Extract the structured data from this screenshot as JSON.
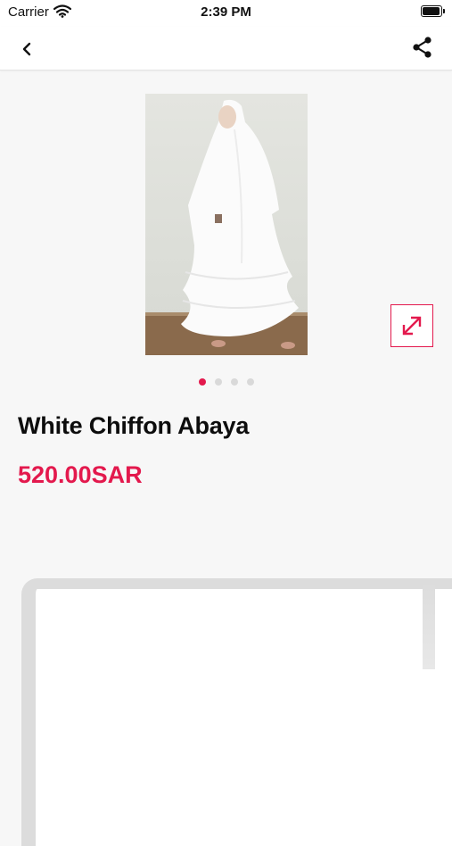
{
  "status_bar": {
    "carrier": "Carrier",
    "time": "2:39 PM"
  },
  "nav": {
    "back_icon": "chevron-left-icon",
    "share_icon": "share-icon"
  },
  "product": {
    "title": "White Chiffon Abaya",
    "price": "520.00SAR",
    "image_count": 4,
    "active_image_index": 0
  },
  "colors": {
    "accent": "#e3194d",
    "title": "#0d0d0d",
    "background": "#f7f7f7"
  }
}
